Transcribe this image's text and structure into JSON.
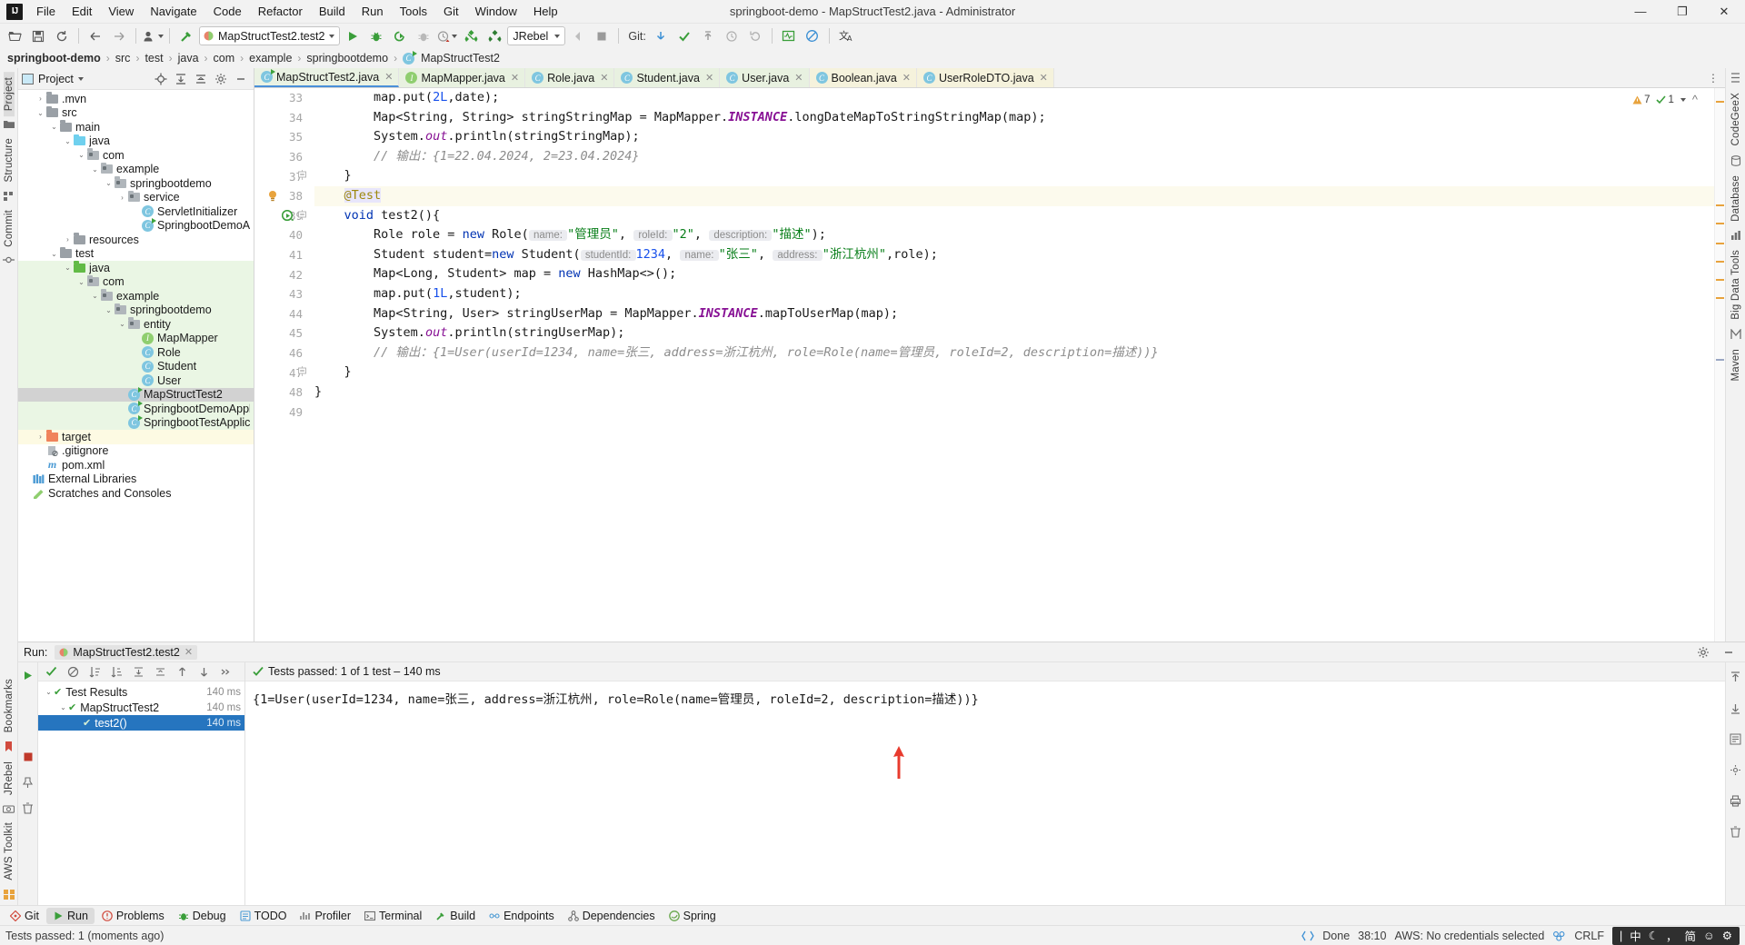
{
  "window": {
    "title": "springboot-demo - MapStructTest2.java - Administrator",
    "minimize": "—",
    "maximize": "❐",
    "close": "✕"
  },
  "menubar": [
    {
      "label": "File"
    },
    {
      "label": "Edit"
    },
    {
      "label": "View"
    },
    {
      "label": "Navigate"
    },
    {
      "label": "Code"
    },
    {
      "label": "Refactor"
    },
    {
      "label": "Build"
    },
    {
      "label": "Run"
    },
    {
      "label": "Tools"
    },
    {
      "label": "Git"
    },
    {
      "label": "Window"
    },
    {
      "label": "Help"
    }
  ],
  "toolbar": {
    "run_config": "MapStructTest2.test2",
    "jrebel": "JRebel",
    "git_label": "Git:"
  },
  "breadcrumb": {
    "segments": [
      {
        "label": "springboot-demo",
        "bold": true
      },
      {
        "label": "src",
        "bold": false
      },
      {
        "label": "test",
        "bold": false
      },
      {
        "label": "java",
        "bold": false
      },
      {
        "label": "com",
        "bold": false
      },
      {
        "label": "example",
        "bold": false
      },
      {
        "label": "springbootdemo",
        "bold": false
      },
      {
        "label": "MapStructTest2",
        "bold": false,
        "icon": "class-icon"
      }
    ]
  },
  "left_strip": [
    {
      "label": "Project",
      "active": true
    },
    {
      "label": "Structure",
      "active": false
    },
    {
      "label": "Commit",
      "active": false
    }
  ],
  "right_strip": [
    {
      "label": "CodeGeeX"
    },
    {
      "label": "Database"
    },
    {
      "label": "Big Data Tools"
    },
    {
      "label": "Maven"
    }
  ],
  "left_bottom_strip": [
    {
      "label": "Bookmarks"
    },
    {
      "label": "JRebel"
    },
    {
      "label": "AWS Toolkit"
    }
  ],
  "project_panel": {
    "title": "Project",
    "tree": [
      {
        "depth": 1,
        "arrow": "›",
        "icon": "folder-gray",
        "label": ".mvn",
        "bg": ""
      },
      {
        "depth": 1,
        "arrow": "⌄",
        "icon": "folder-gray",
        "label": "src",
        "bg": ""
      },
      {
        "depth": 2,
        "arrow": "⌄",
        "icon": "folder-gray",
        "label": "main",
        "bg": ""
      },
      {
        "depth": 3,
        "arrow": "⌄",
        "icon": "folder-cyan",
        "label": "java",
        "bg": ""
      },
      {
        "depth": 4,
        "arrow": "⌄",
        "icon": "folder-pkg",
        "label": "com",
        "bg": ""
      },
      {
        "depth": 5,
        "arrow": "⌄",
        "icon": "folder-pkg",
        "label": "example",
        "bg": ""
      },
      {
        "depth": 6,
        "arrow": "⌄",
        "icon": "folder-pkg",
        "label": "springbootdemo",
        "bg": ""
      },
      {
        "depth": 7,
        "arrow": "›",
        "icon": "folder-pkg",
        "label": "service",
        "bg": ""
      },
      {
        "depth": 8,
        "arrow": "",
        "icon": "class",
        "label": "ServletInitializer",
        "bg": ""
      },
      {
        "depth": 8,
        "arrow": "",
        "icon": "class-run",
        "label": "SpringbootDemoApplication",
        "bg": ""
      },
      {
        "depth": 3,
        "arrow": "›",
        "icon": "folder-res",
        "label": "resources",
        "bg": ""
      },
      {
        "depth": 2,
        "arrow": "⌄",
        "icon": "folder-gray",
        "label": "test",
        "bg": ""
      },
      {
        "depth": 3,
        "arrow": "⌄",
        "icon": "folder-green",
        "label": "java",
        "bg": "green"
      },
      {
        "depth": 4,
        "arrow": "⌄",
        "icon": "folder-pkg",
        "label": "com",
        "bg": "green"
      },
      {
        "depth": 5,
        "arrow": "⌄",
        "icon": "folder-pkg",
        "label": "example",
        "bg": "green"
      },
      {
        "depth": 6,
        "arrow": "⌄",
        "icon": "folder-pkg",
        "label": "springbootdemo",
        "bg": "green"
      },
      {
        "depth": 7,
        "arrow": "⌄",
        "icon": "folder-pkg",
        "label": "entity",
        "bg": "green"
      },
      {
        "depth": 8,
        "arrow": "",
        "icon": "interface",
        "label": "MapMapper",
        "bg": "green"
      },
      {
        "depth": 8,
        "arrow": "",
        "icon": "class",
        "label": "Role",
        "bg": "green"
      },
      {
        "depth": 8,
        "arrow": "",
        "icon": "class",
        "label": "Student",
        "bg": "green"
      },
      {
        "depth": 8,
        "arrow": "",
        "icon": "class",
        "label": "User",
        "bg": "green"
      },
      {
        "depth": 7,
        "arrow": "",
        "icon": "class-run",
        "label": "MapStructTest2",
        "bg": "sel"
      },
      {
        "depth": 7,
        "arrow": "",
        "icon": "class-run",
        "label": "SpringbootDemoApplicationTests",
        "bg": "green"
      },
      {
        "depth": 7,
        "arrow": "",
        "icon": "class-run",
        "label": "SpringbootTestApplicationTests",
        "bg": "green"
      },
      {
        "depth": 1,
        "arrow": "›",
        "icon": "folder-orange",
        "label": "target",
        "bg": "yellow"
      },
      {
        "depth": 1,
        "arrow": "",
        "icon": "gitignore",
        "label": ".gitignore",
        "bg": ""
      },
      {
        "depth": 1,
        "arrow": "",
        "icon": "maven",
        "label": "pom.xml",
        "bg": ""
      },
      {
        "depth": 0,
        "arrow": "",
        "icon": "libs",
        "label": "External Libraries",
        "bg": ""
      },
      {
        "depth": 0,
        "arrow": "",
        "icon": "scratches",
        "label": "Scratches and Consoles",
        "bg": ""
      }
    ]
  },
  "editor": {
    "tabs": [
      {
        "label": "MapStructTest2.java",
        "icon": "class-run-icon",
        "active": true,
        "style": "active"
      },
      {
        "label": "MapMapper.java",
        "icon": "interface-icon",
        "active": false,
        "style": "green"
      },
      {
        "label": "Role.java",
        "icon": "class-icon",
        "active": false,
        "style": "green"
      },
      {
        "label": "Student.java",
        "icon": "class-icon",
        "active": false,
        "style": "green"
      },
      {
        "label": "User.java",
        "icon": "class-icon",
        "active": false,
        "style": "green"
      },
      {
        "label": "Boolean.java",
        "icon": "class-icon",
        "active": false,
        "style": "yellowish"
      },
      {
        "label": "UserRoleDTO.java",
        "icon": "class-icon",
        "active": false,
        "style": "yellowish"
      }
    ],
    "inspections": {
      "warnings": "7",
      "checks": "1"
    },
    "lines": [
      {
        "n": 33,
        "indent": 2,
        "hl": false,
        "fold": "",
        "tokens": [
          {
            "t": "map.put(",
            "c": ""
          },
          {
            "t": "2L",
            "c": "num"
          },
          {
            "t": ",date);",
            "c": ""
          }
        ]
      },
      {
        "n": 34,
        "indent": 2,
        "hl": false,
        "fold": "",
        "tokens": [
          {
            "t": "Map<String, String> stringStringMap = MapMapper.",
            "c": ""
          },
          {
            "t": "INSTANCE",
            "c": "statb"
          },
          {
            "t": ".longDateMapToStringStringMap(map);",
            "c": ""
          }
        ]
      },
      {
        "n": 35,
        "indent": 2,
        "hl": false,
        "fold": "",
        "tokens": [
          {
            "t": "System.",
            "c": ""
          },
          {
            "t": "out",
            "c": "stat"
          },
          {
            "t": ".println(stringStringMap);",
            "c": ""
          }
        ]
      },
      {
        "n": 36,
        "indent": 2,
        "hl": false,
        "fold": "",
        "tokens": [
          {
            "t": "// 输出：{1=22.04.2024, 2=23.04.2024}",
            "c": "cmt"
          }
        ]
      },
      {
        "n": 37,
        "indent": 1,
        "hl": false,
        "fold": "−",
        "tokens": [
          {
            "t": "}",
            "c": ""
          }
        ]
      },
      {
        "n": 38,
        "indent": 1,
        "hl": true,
        "fold": "",
        "gutter_icon": "bulb",
        "tokens": [
          {
            "t": "@Test",
            "c": "ann annbg"
          }
        ]
      },
      {
        "n": 39,
        "indent": 1,
        "hl": false,
        "fold": "−",
        "gutter_icon": "run-test",
        "tokens": [
          {
            "t": "void",
            "c": "kw"
          },
          {
            "t": " test2(){",
            "c": ""
          }
        ]
      },
      {
        "n": 40,
        "indent": 2,
        "hl": false,
        "fold": "",
        "tokens": [
          {
            "t": "Role role = ",
            "c": ""
          },
          {
            "t": "new",
            "c": "kw"
          },
          {
            "t": " Role(",
            "c": ""
          },
          {
            "t": " name: ",
            "c": "hint"
          },
          {
            "t": "\"管理员\"",
            "c": "str"
          },
          {
            "t": ", ",
            "c": ""
          },
          {
            "t": " roleId: ",
            "c": "hint"
          },
          {
            "t": "\"2\"",
            "c": "str"
          },
          {
            "t": ", ",
            "c": ""
          },
          {
            "t": " description: ",
            "c": "hint"
          },
          {
            "t": "\"描述\"",
            "c": "str"
          },
          {
            "t": ");",
            "c": ""
          }
        ]
      },
      {
        "n": 41,
        "indent": 2,
        "hl": false,
        "fold": "",
        "tokens": [
          {
            "t": "Student student=",
            "c": ""
          },
          {
            "t": "new",
            "c": "kw"
          },
          {
            "t": " Student(",
            "c": ""
          },
          {
            "t": " studentId: ",
            "c": "hint"
          },
          {
            "t": "1234",
            "c": "num"
          },
          {
            "t": ", ",
            "c": ""
          },
          {
            "t": " name: ",
            "c": "hint"
          },
          {
            "t": "\"张三\"",
            "c": "str"
          },
          {
            "t": ", ",
            "c": ""
          },
          {
            "t": " address: ",
            "c": "hint"
          },
          {
            "t": "\"浙江杭州\"",
            "c": "str"
          },
          {
            "t": ",role);",
            "c": ""
          }
        ]
      },
      {
        "n": 42,
        "indent": 2,
        "hl": false,
        "fold": "",
        "tokens": [
          {
            "t": "Map<Long, Student> map = ",
            "c": ""
          },
          {
            "t": "new",
            "c": "kw"
          },
          {
            "t": " HashMap<>();",
            "c": ""
          }
        ]
      },
      {
        "n": 43,
        "indent": 2,
        "hl": false,
        "fold": "",
        "tokens": [
          {
            "t": "map.put(",
            "c": ""
          },
          {
            "t": "1L",
            "c": "num"
          },
          {
            "t": ",student);",
            "c": ""
          }
        ]
      },
      {
        "n": 44,
        "indent": 2,
        "hl": false,
        "fold": "",
        "tokens": [
          {
            "t": "Map<String, User> stringUserMap = MapMapper.",
            "c": ""
          },
          {
            "t": "INSTANCE",
            "c": "statb"
          },
          {
            "t": ".mapToUserMap(map);",
            "c": ""
          }
        ]
      },
      {
        "n": 45,
        "indent": 2,
        "hl": false,
        "fold": "",
        "tokens": [
          {
            "t": "System.",
            "c": ""
          },
          {
            "t": "out",
            "c": "stat"
          },
          {
            "t": ".println(stringUserMap);",
            "c": ""
          }
        ]
      },
      {
        "n": 46,
        "indent": 2,
        "hl": false,
        "fold": "",
        "tokens": [
          {
            "t": "// 输出：{1=User(userId=1234, name=张三, address=浙江杭州, role=Role(name=管理员, roleId=2, description=描述))}",
            "c": "cmt"
          }
        ]
      },
      {
        "n": 47,
        "indent": 1,
        "hl": false,
        "fold": "−",
        "tokens": [
          {
            "t": "}",
            "c": ""
          }
        ]
      },
      {
        "n": 48,
        "indent": 0,
        "hl": false,
        "fold": "",
        "tokens": [
          {
            "t": "}",
            "c": ""
          }
        ]
      },
      {
        "n": 49,
        "indent": 0,
        "hl": false,
        "fold": "",
        "tokens": [
          {
            "t": "",
            "c": ""
          }
        ]
      }
    ]
  },
  "run_panel": {
    "label": "Run:",
    "tab": "MapStructTest2.test2",
    "status": "Tests passed: 1 of 1 test – 140 ms",
    "tree": [
      {
        "depth": 0,
        "label": "Test Results",
        "time": "140 ms",
        "sel": false,
        "arrow": "⌄"
      },
      {
        "depth": 1,
        "label": "MapStructTest2",
        "time": "140 ms",
        "sel": false,
        "arrow": "⌄"
      },
      {
        "depth": 2,
        "label": "test2()",
        "time": "140 ms",
        "sel": true,
        "arrow": ""
      }
    ],
    "console": "{1=User(userId=1234, name=张三, address=浙江杭州, role=Role(name=管理员, roleId=2, description=描述))}"
  },
  "tool_window_bar": [
    {
      "label": "Git",
      "icon": "git-icon",
      "active": false
    },
    {
      "label": "Run",
      "icon": "run-icon",
      "active": true
    },
    {
      "label": "Problems",
      "icon": "problems-icon",
      "active": false
    },
    {
      "label": "Debug",
      "icon": "debug-icon",
      "active": false
    },
    {
      "label": "TODO",
      "icon": "todo-icon",
      "active": false
    },
    {
      "label": "Profiler",
      "icon": "profiler-icon",
      "active": false
    },
    {
      "label": "Terminal",
      "icon": "terminal-icon",
      "active": false
    },
    {
      "label": "Build",
      "icon": "build-icon",
      "active": false
    },
    {
      "label": "Endpoints",
      "icon": "endpoints-icon",
      "active": false
    },
    {
      "label": "Dependencies",
      "icon": "dependencies-icon",
      "active": false
    },
    {
      "label": "Spring",
      "icon": "spring-icon",
      "active": false
    }
  ],
  "status_bar": {
    "message": "Tests passed: 1 (moments ago)",
    "done": "Done",
    "position": "38:10",
    "aws": "AWS: No credentials selected",
    "encoding": "CRLF",
    "ime": {
      "sep": "|",
      "lang": "中",
      "moon": "☾",
      "comma": "，",
      "simplified": "简",
      "smiley": "☺",
      "gear": "⚙"
    }
  },
  "colors": {
    "accent_blue": "#2675bf",
    "green_test": "#3a9e3a",
    "warning_yellow": "#e8a33d",
    "string_green": "#067d17",
    "keyword_blue": "#0033b3",
    "number_blue": "#1750eb",
    "red_arrow": "#e83b2e"
  }
}
